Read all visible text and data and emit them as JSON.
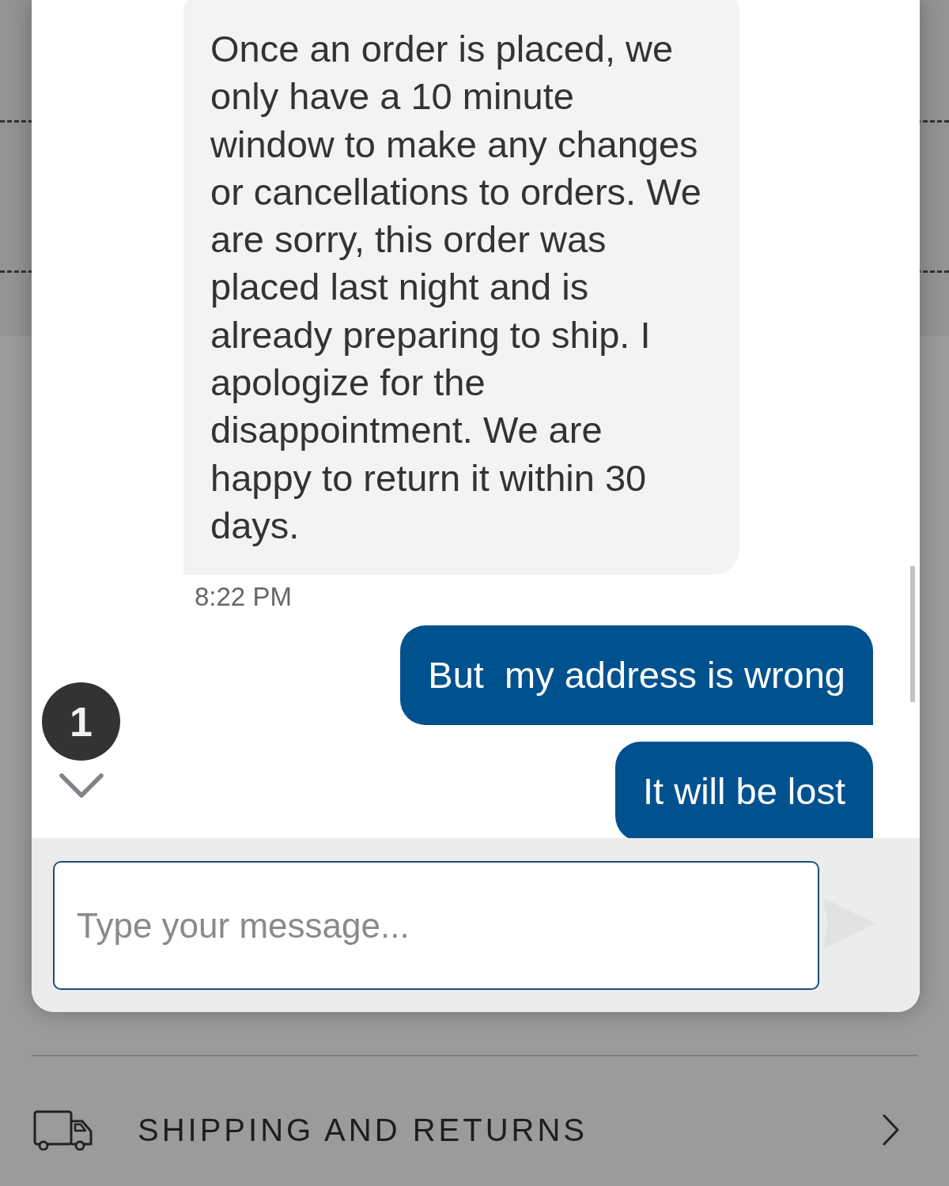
{
  "chat": {
    "messages": [
      {
        "kind": "incoming",
        "text": "Once an order is placed, we only have a 10 minute window to make any changes or cancellations to orders. We are sorry, this order was placed last night and is already preparing to ship. I apologize for the disappointment. We are happy to return it within 30 days.",
        "time": "8:22 PM"
      },
      {
        "kind": "outgoing",
        "text": "But  my address is wrong"
      },
      {
        "kind": "outgoing",
        "text": "It will be lost"
      }
    ],
    "unread_count": "1",
    "composer": {
      "placeholder": "Type your message...",
      "send_disabled": true
    }
  },
  "page": {
    "accordion": {
      "label": "SHIPPING AND RETURNS"
    }
  }
}
